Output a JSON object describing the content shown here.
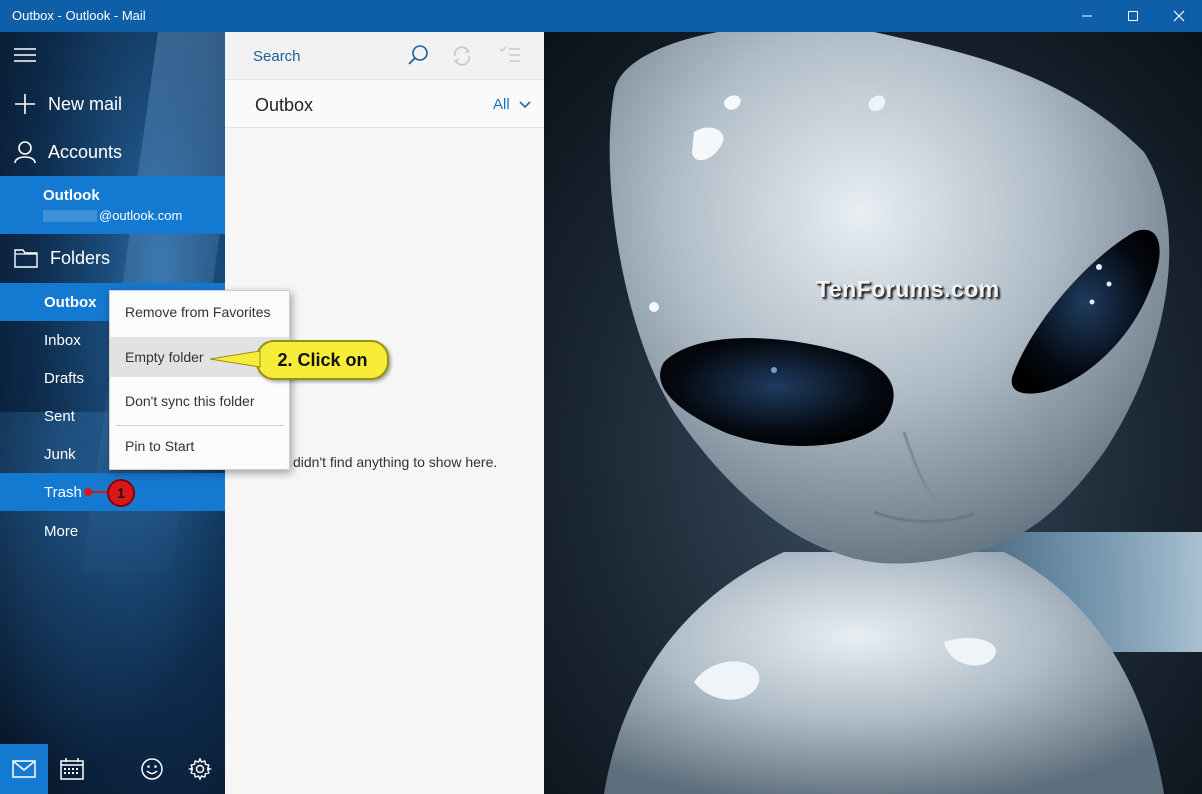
{
  "window": {
    "title": "Outbox - Outlook - Mail"
  },
  "nav": {
    "new_mail": "New mail",
    "accounts": "Accounts",
    "account": {
      "name": "Outlook",
      "email_suffix": "@outlook.com"
    },
    "folders_label": "Folders",
    "folders": [
      {
        "label": "Outbox",
        "selected": true
      },
      {
        "label": "Inbox"
      },
      {
        "label": "Drafts"
      },
      {
        "label": "Sent"
      },
      {
        "label": "Junk"
      },
      {
        "label": "Trash"
      },
      {
        "label": "More"
      }
    ]
  },
  "list": {
    "search_placeholder": "Search",
    "title": "Outbox",
    "filter": "All",
    "empty_message": "didn't find anything to show here."
  },
  "context_menu": {
    "items": [
      "Remove from Favorites",
      "Empty folder",
      "Don't sync this folder",
      "Pin to Start"
    ],
    "highlighted": "Empty folder"
  },
  "annotations": {
    "callout": "2. Click on",
    "step_badge": "1"
  },
  "watermark": "TenForums.com",
  "colors": {
    "titlebar": "#0f5ea8",
    "accent": "#1479d0",
    "callout": "#f7ec3a",
    "badge": "#d81818"
  },
  "icons": [
    "hamburger-icon",
    "plus-icon",
    "person-icon",
    "folder-icon",
    "search-icon",
    "sync-icon",
    "select-icon",
    "mail-icon",
    "calendar-icon",
    "smiley-icon",
    "gear-icon",
    "minimize-icon",
    "maximize-icon",
    "close-icon",
    "chevron-down-icon"
  ]
}
